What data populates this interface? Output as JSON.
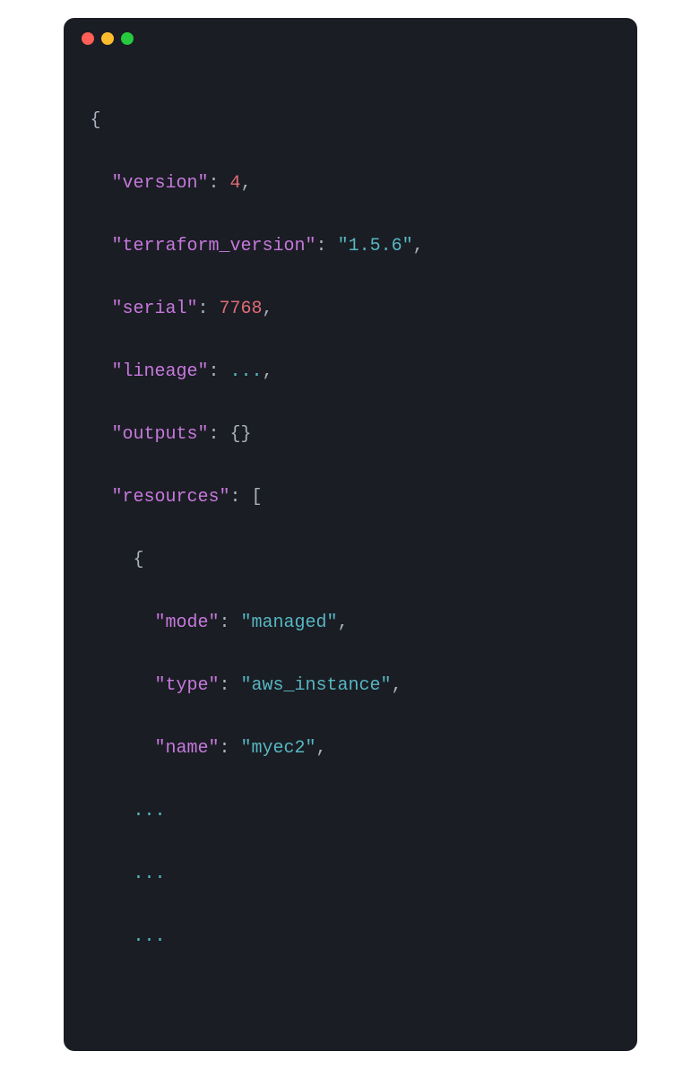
{
  "titlebar": {
    "dots": [
      "red",
      "yellow",
      "green"
    ]
  },
  "code": {
    "open_brace": "{",
    "keys": {
      "version": "\"version\"",
      "terraform_version": "\"terraform_version\"",
      "serial": "\"serial\"",
      "lineage": "\"lineage\"",
      "outputs": "\"outputs\"",
      "resources": "\"resources\"",
      "mode": "\"mode\"",
      "type": "\"type\"",
      "name": "\"name\""
    },
    "values": {
      "version": "4",
      "terraform_version": "\"1.5.6\"",
      "serial": "7768",
      "lineage_ellipsis": "...",
      "outputs_empty": "{}",
      "mode": "\"managed\"",
      "type": "\"aws_instance\"",
      "name": "\"myec2\""
    },
    "punct": {
      "colon_space": ": ",
      "comma": ",",
      "open_bracket": "[",
      "open_brace_inner": "{",
      "ellipsis": "..."
    }
  }
}
